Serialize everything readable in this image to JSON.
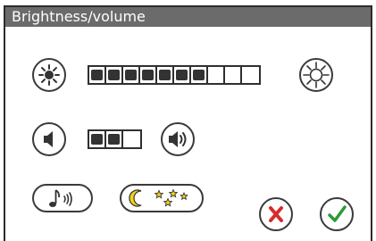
{
  "window": {
    "title": "Brightness/volume"
  },
  "brightness": {
    "levels_total": 10,
    "level": 7,
    "decrease_icon": "sun-small-icon",
    "increase_icon": "sun-large-icon"
  },
  "volume": {
    "levels_total": 3,
    "level": 2,
    "decrease_icon": "speaker-quiet-icon",
    "increase_icon": "speaker-loud-icon"
  },
  "modes": [
    {
      "name": "sound-mode",
      "icon": "music-note-sound-icon"
    },
    {
      "name": "night-mode",
      "icon": "moon-stars-icon",
      "accent": "#f2d21b"
    }
  ],
  "actions": {
    "cancel_icon": "red-x-icon",
    "cancel_color": "#d62c2c",
    "confirm_icon": "green-check-icon",
    "confirm_color": "#2e9a35"
  }
}
